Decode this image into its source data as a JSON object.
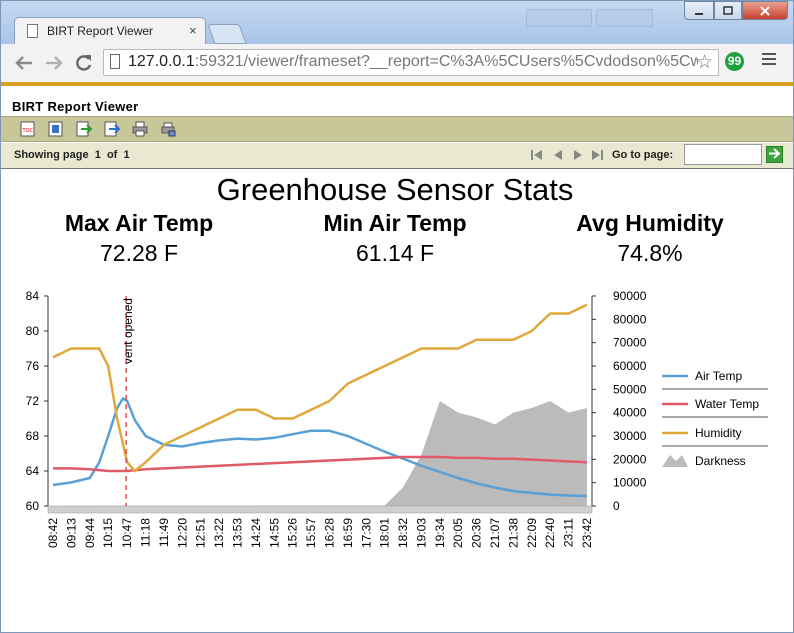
{
  "browser": {
    "tab_title": "BIRT Report Viewer",
    "tab_close": "×",
    "url_host": "127.0.0.1",
    "url_rest": ":59321/viewer/frameset?__report=C%3A%5CUsers%5Cvdodson%5Cwor",
    "back_icon": "back-arrow-icon",
    "forward_icon": "forward-arrow-icon",
    "reload_icon": "reload-icon",
    "extension_glyph": "99"
  },
  "viewer": {
    "title": "BIRT Report Viewer",
    "showing_page_label": "Showing page",
    "current_page": "1",
    "of_label": "of",
    "total_pages": "1",
    "goto_label": "Go to page:",
    "goto_value": ""
  },
  "report": {
    "title": "Greenhouse Sensor Stats",
    "stats": [
      {
        "label": "Max Air Temp",
        "value": "72.28 F"
      },
      {
        "label": "Min Air Temp",
        "value": "61.14 F"
      },
      {
        "label": "Avg Humidity",
        "value": "74.8%"
      }
    ]
  },
  "chart_data": {
    "type": "line",
    "title": "",
    "xlabel": "",
    "ylabel": "",
    "y_left_lim": [
      60,
      84
    ],
    "y_left_ticks": [
      60,
      64,
      68,
      72,
      76,
      80,
      84
    ],
    "y_right_lim": [
      0,
      90000
    ],
    "y_right_ticks": [
      0,
      10000,
      20000,
      30000,
      40000,
      50000,
      60000,
      70000,
      80000,
      90000
    ],
    "x_ticks": [
      "08:42",
      "09:13",
      "09:44",
      "10:15",
      "10:47",
      "11:18",
      "11:49",
      "12:20",
      "12:51",
      "13:22",
      "13:53",
      "14:24",
      "14:55",
      "15:26",
      "15:57",
      "16:28",
      "16:59",
      "17:30",
      "18:01",
      "18:32",
      "19:03",
      "19:34",
      "20:05",
      "20:36",
      "21:07",
      "21:38",
      "22:09",
      "22:40",
      "23:11",
      "23:42"
    ],
    "annotation": {
      "label": "vent opened",
      "x": "10:47"
    },
    "legend_position": "right",
    "series": [
      {
        "name": "Air Temp",
        "color": "#5aa0d6",
        "axis": "left",
        "x": [
          "08:42",
          "09:13",
          "09:44",
          "10:00",
          "10:15",
          "10:30",
          "10:40",
          "10:47",
          "11:00",
          "11:18",
          "11:49",
          "12:20",
          "12:51",
          "13:22",
          "13:53",
          "14:24",
          "14:55",
          "15:26",
          "15:57",
          "16:28",
          "16:59",
          "17:30",
          "18:01",
          "18:32",
          "19:03",
          "19:34",
          "20:05",
          "20:36",
          "21:07",
          "21:38",
          "22:09",
          "22:40",
          "23:11",
          "23:42"
        ],
        "y": [
          62.4,
          62.7,
          63.2,
          65.0,
          68.0,
          71.2,
          72.28,
          72.0,
          69.8,
          68.0,
          67.0,
          66.8,
          67.2,
          67.5,
          67.7,
          67.6,
          67.8,
          68.2,
          68.6,
          68.6,
          68.0,
          67.1,
          66.2,
          65.4,
          64.6,
          63.9,
          63.2,
          62.6,
          62.1,
          61.7,
          61.5,
          61.3,
          61.2,
          61.14
        ]
      },
      {
        "name": "Water Temp",
        "color": "#e05a6a",
        "axis": "left",
        "x": [
          "08:42",
          "09:13",
          "09:44",
          "10:15",
          "10:47",
          "11:18",
          "11:49",
          "12:20",
          "12:51",
          "13:22",
          "13:53",
          "14:24",
          "14:55",
          "15:26",
          "15:57",
          "16:28",
          "16:59",
          "17:30",
          "18:01",
          "18:32",
          "19:03",
          "19:34",
          "20:05",
          "20:36",
          "21:07",
          "21:38",
          "22:09",
          "22:40",
          "23:11",
          "23:42"
        ],
        "y": [
          64.3,
          64.3,
          64.2,
          64.0,
          64.0,
          64.2,
          64.3,
          64.4,
          64.5,
          64.6,
          64.7,
          64.8,
          64.9,
          65.0,
          65.1,
          65.2,
          65.3,
          65.4,
          65.5,
          65.6,
          65.6,
          65.6,
          65.5,
          65.5,
          65.4,
          65.4,
          65.3,
          65.2,
          65.1,
          65.0
        ]
      },
      {
        "name": "Humidity",
        "color": "#e0a83a",
        "axis": "left",
        "x": [
          "08:42",
          "09:13",
          "09:44",
          "10:00",
          "10:15",
          "10:30",
          "10:47",
          "11:00",
          "11:18",
          "11:49",
          "12:20",
          "12:51",
          "13:22",
          "13:53",
          "14:24",
          "14:55",
          "15:26",
          "15:57",
          "16:28",
          "16:59",
          "17:30",
          "18:01",
          "18:32",
          "19:03",
          "19:34",
          "20:05",
          "20:36",
          "21:07",
          "21:38",
          "22:09",
          "22:40",
          "23:11",
          "23:42"
        ],
        "y": [
          77,
          78,
          78,
          78,
          76,
          70,
          65,
          64,
          65,
          67,
          68,
          69,
          70,
          71,
          71,
          70,
          70,
          71,
          72,
          74,
          75,
          76,
          77,
          78,
          78,
          78,
          79,
          79,
          79,
          80,
          82,
          82,
          83
        ]
      },
      {
        "name": "Darkness",
        "color": "#bbbbbb",
        "axis": "right",
        "type": "area",
        "x": [
          "08:42",
          "18:01",
          "18:32",
          "19:03",
          "19:34",
          "20:05",
          "20:36",
          "21:07",
          "21:38",
          "22:09",
          "22:40",
          "23:11",
          "23:42"
        ],
        "y": [
          0,
          200,
          8000,
          22000,
          45000,
          40000,
          38000,
          35000,
          40000,
          42000,
          45000,
          40000,
          42000
        ]
      }
    ]
  }
}
